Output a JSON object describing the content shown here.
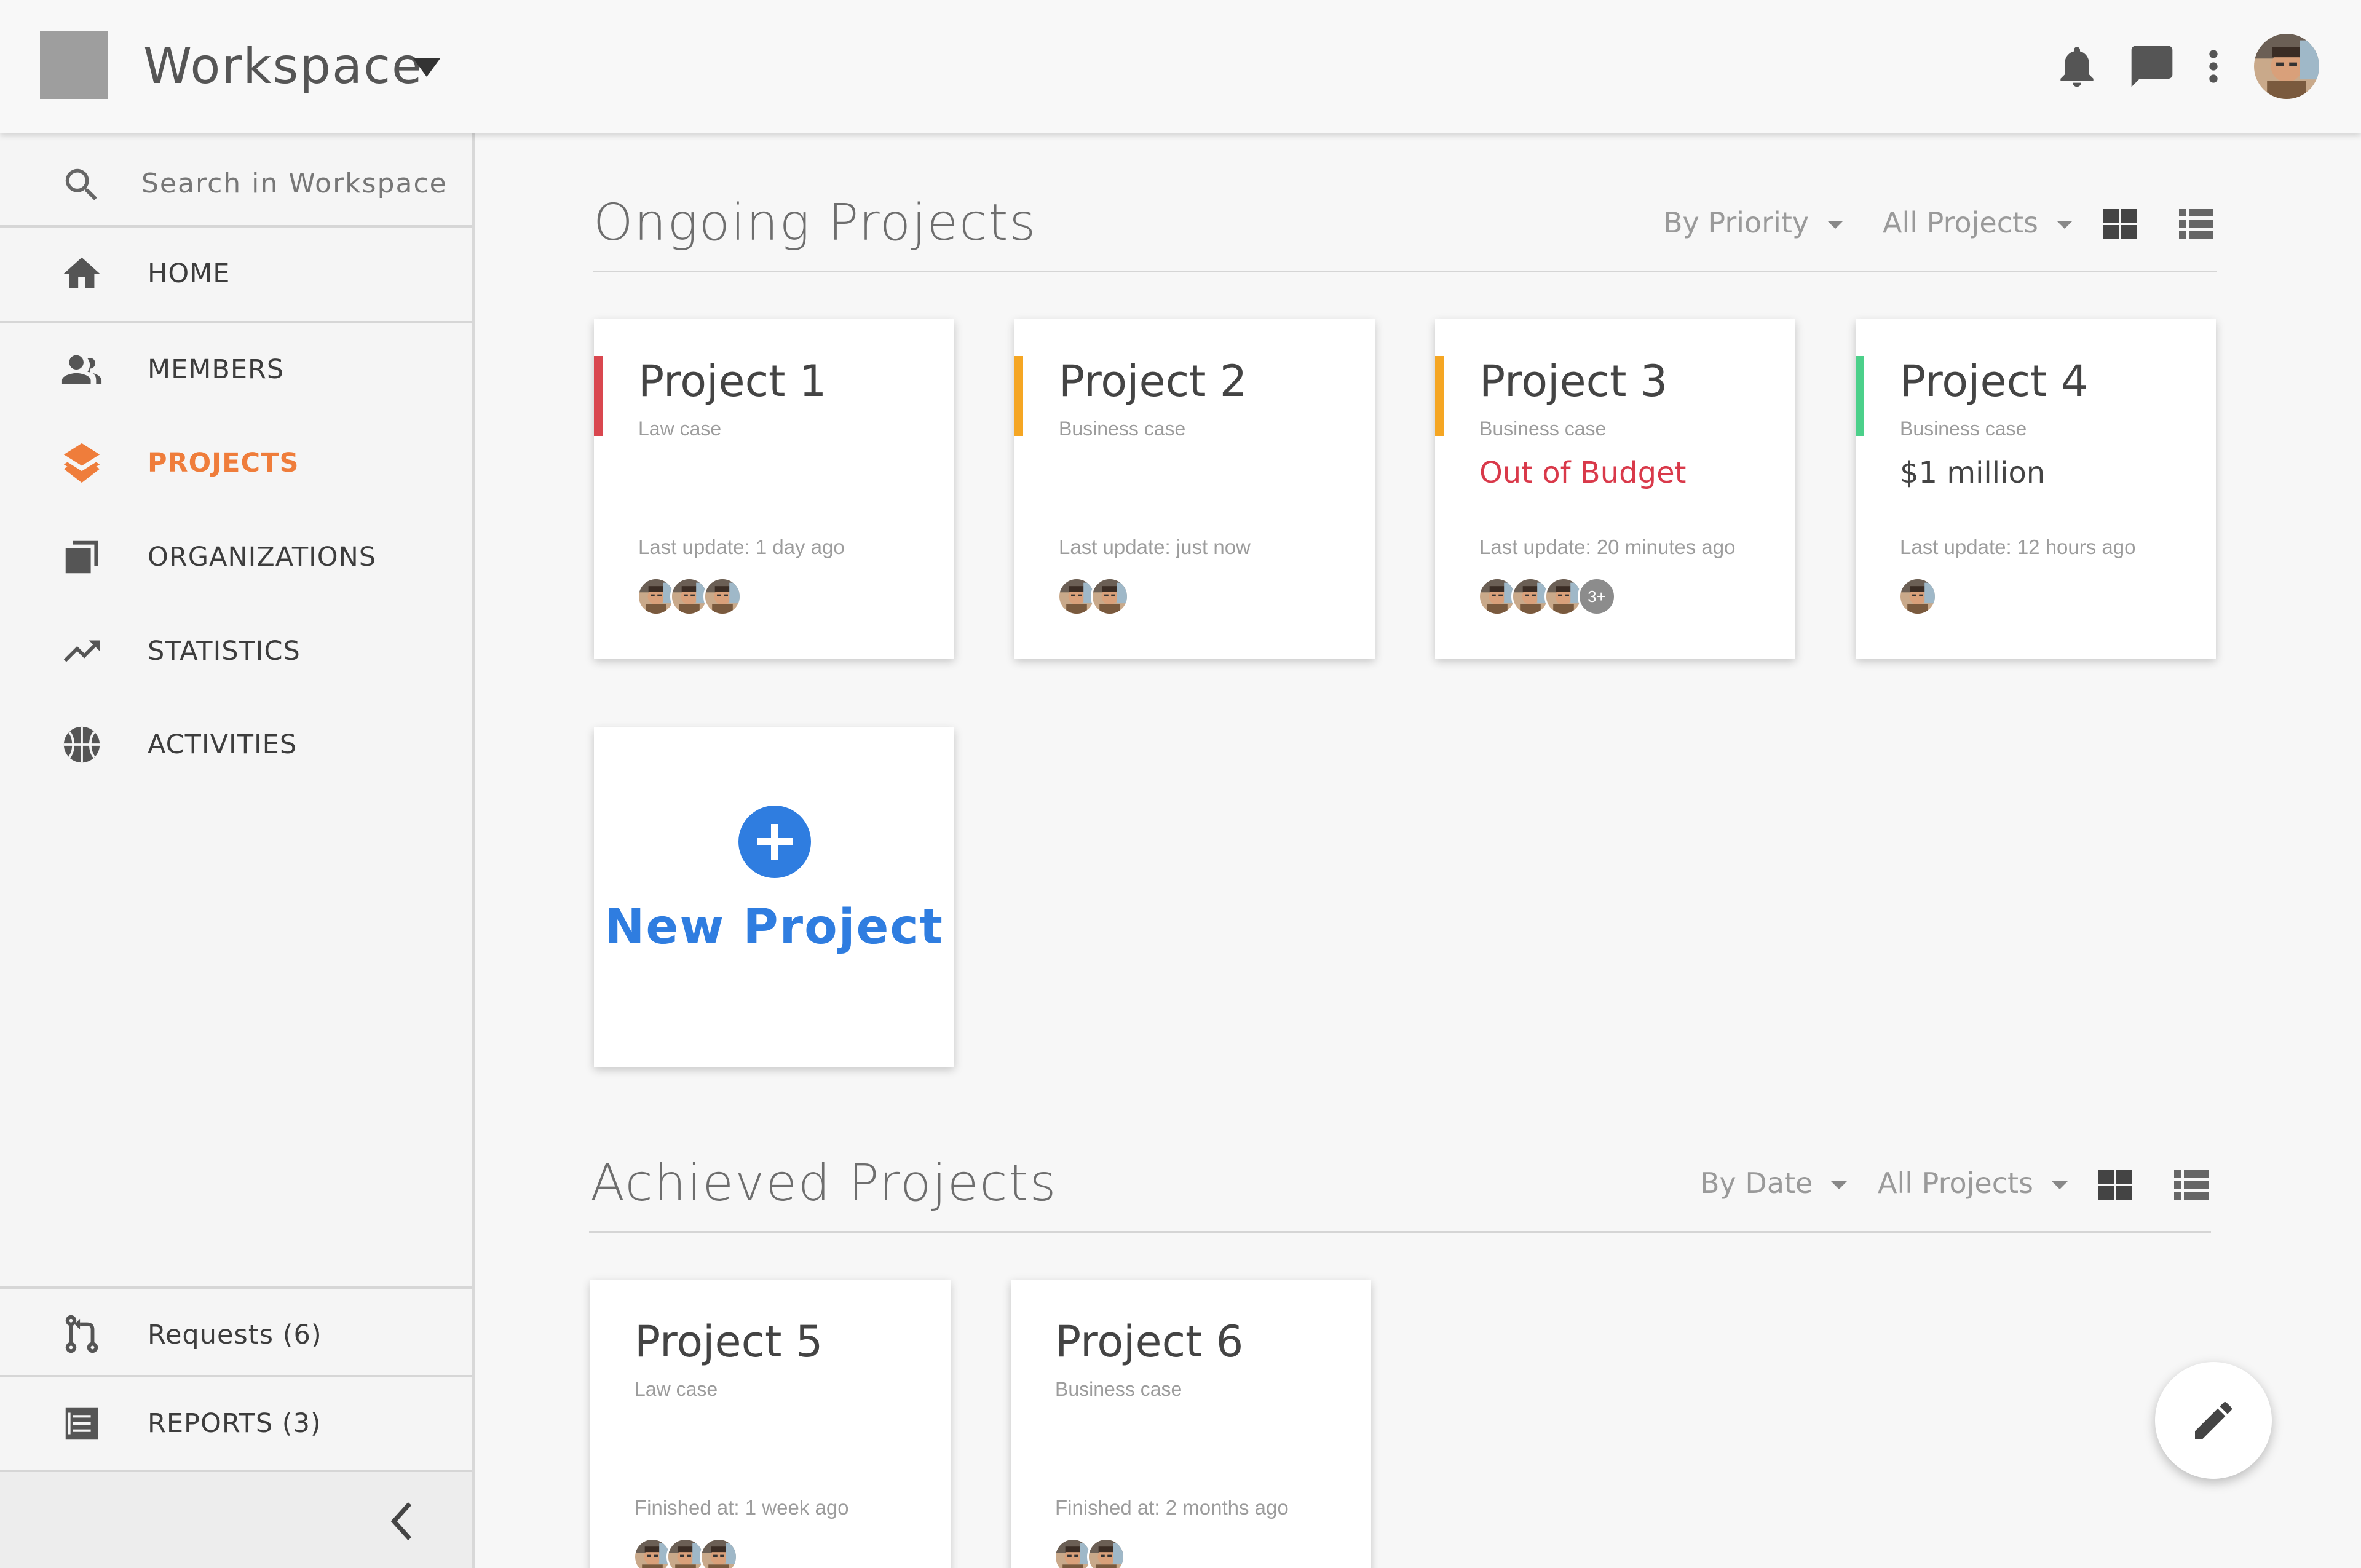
{
  "header": {
    "workspace_name": "Workspace",
    "icons": [
      "bell-icon",
      "chat-icon",
      "more-vert-icon",
      "avatar"
    ]
  },
  "sidebar": {
    "search": {
      "placeholder": "Search in Workspace"
    },
    "items": [
      {
        "label": "HOME",
        "icon": "home-icon"
      },
      {
        "label": "MEMBERS",
        "icon": "members-icon"
      },
      {
        "label": "PROJECTS",
        "icon": "layers-icon",
        "active": true
      },
      {
        "label": "ORGANIZATIONS",
        "icon": "organizations-icon"
      },
      {
        "label": "STATISTICS",
        "icon": "trending-up-icon"
      },
      {
        "label": "ACTIVITIES",
        "icon": "basketball-icon"
      }
    ],
    "bottom_items": [
      {
        "label": "Requests (6)",
        "icon": "pull-request-icon"
      },
      {
        "label": "REPORTS (3)",
        "icon": "reports-icon"
      }
    ]
  },
  "ongoing": {
    "title": "Ongoing Projects",
    "sort_label": "By Priority",
    "filter_label": "All Projects",
    "projects": [
      {
        "name": "Project 1",
        "type": "Law case",
        "status": "",
        "update": "Last update: 1 day ago",
        "stripe": "#d9474f",
        "avatar_count": 3,
        "more": ""
      },
      {
        "name": "Project 2",
        "type": "Business case",
        "status": "",
        "update": "Last update: just now",
        "stripe": "#f5a623",
        "avatar_count": 2,
        "more": ""
      },
      {
        "name": "Project 3",
        "type": "Business case",
        "status": "Out of Budget",
        "status_color": "#d9394a",
        "update": "Last update: 20 minutes ago",
        "stripe": "#f5a623",
        "avatar_count": 3,
        "more": "3+"
      },
      {
        "name": "Project 4",
        "type": "Business case",
        "status": "$1 million",
        "status_color": "#444444",
        "update": "Last update: 12 hours ago",
        "stripe": "#4cd08a",
        "avatar_count": 1,
        "more": ""
      }
    ],
    "new_project_label": "New Project"
  },
  "achieved": {
    "title": "Achieved Projects",
    "sort_label": "By Date",
    "filter_label": "All Projects",
    "projects": [
      {
        "name": "Project 5",
        "type": "Law case",
        "update": "Finished at: 1 week ago",
        "avatar_count": 3
      },
      {
        "name": "Project 6",
        "type": "Business case",
        "update": "Finished at: 2 months ago",
        "avatar_count": 2
      }
    ]
  },
  "colors": {
    "accent_orange": "#ef7d3b",
    "accent_blue": "#2f7de0"
  }
}
